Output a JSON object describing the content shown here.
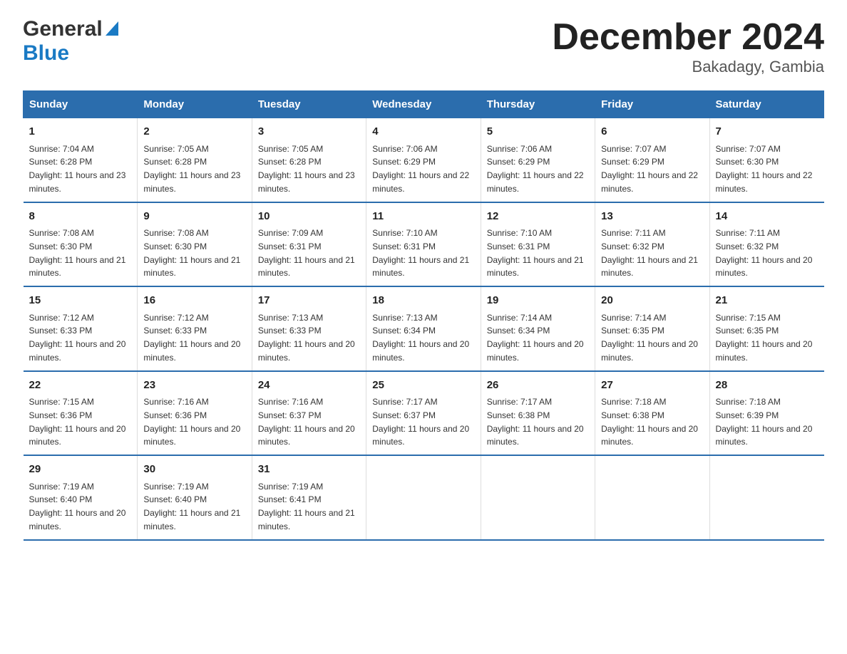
{
  "header": {
    "logo_general": "General",
    "logo_blue": "Blue",
    "title": "December 2024",
    "subtitle": "Bakadagy, Gambia"
  },
  "calendar": {
    "days_of_week": [
      "Sunday",
      "Monday",
      "Tuesday",
      "Wednesday",
      "Thursday",
      "Friday",
      "Saturday"
    ],
    "weeks": [
      [
        {
          "day": "1",
          "sunrise": "7:04 AM",
          "sunset": "6:28 PM",
          "daylight": "11 hours and 23 minutes."
        },
        {
          "day": "2",
          "sunrise": "7:05 AM",
          "sunset": "6:28 PM",
          "daylight": "11 hours and 23 minutes."
        },
        {
          "day": "3",
          "sunrise": "7:05 AM",
          "sunset": "6:28 PM",
          "daylight": "11 hours and 23 minutes."
        },
        {
          "day": "4",
          "sunrise": "7:06 AM",
          "sunset": "6:29 PM",
          "daylight": "11 hours and 22 minutes."
        },
        {
          "day": "5",
          "sunrise": "7:06 AM",
          "sunset": "6:29 PM",
          "daylight": "11 hours and 22 minutes."
        },
        {
          "day": "6",
          "sunrise": "7:07 AM",
          "sunset": "6:29 PM",
          "daylight": "11 hours and 22 minutes."
        },
        {
          "day": "7",
          "sunrise": "7:07 AM",
          "sunset": "6:30 PM",
          "daylight": "11 hours and 22 minutes."
        }
      ],
      [
        {
          "day": "8",
          "sunrise": "7:08 AM",
          "sunset": "6:30 PM",
          "daylight": "11 hours and 21 minutes."
        },
        {
          "day": "9",
          "sunrise": "7:08 AM",
          "sunset": "6:30 PM",
          "daylight": "11 hours and 21 minutes."
        },
        {
          "day": "10",
          "sunrise": "7:09 AM",
          "sunset": "6:31 PM",
          "daylight": "11 hours and 21 minutes."
        },
        {
          "day": "11",
          "sunrise": "7:10 AM",
          "sunset": "6:31 PM",
          "daylight": "11 hours and 21 minutes."
        },
        {
          "day": "12",
          "sunrise": "7:10 AM",
          "sunset": "6:31 PM",
          "daylight": "11 hours and 21 minutes."
        },
        {
          "day": "13",
          "sunrise": "7:11 AM",
          "sunset": "6:32 PM",
          "daylight": "11 hours and 21 minutes."
        },
        {
          "day": "14",
          "sunrise": "7:11 AM",
          "sunset": "6:32 PM",
          "daylight": "11 hours and 20 minutes."
        }
      ],
      [
        {
          "day": "15",
          "sunrise": "7:12 AM",
          "sunset": "6:33 PM",
          "daylight": "11 hours and 20 minutes."
        },
        {
          "day": "16",
          "sunrise": "7:12 AM",
          "sunset": "6:33 PM",
          "daylight": "11 hours and 20 minutes."
        },
        {
          "day": "17",
          "sunrise": "7:13 AM",
          "sunset": "6:33 PM",
          "daylight": "11 hours and 20 minutes."
        },
        {
          "day": "18",
          "sunrise": "7:13 AM",
          "sunset": "6:34 PM",
          "daylight": "11 hours and 20 minutes."
        },
        {
          "day": "19",
          "sunrise": "7:14 AM",
          "sunset": "6:34 PM",
          "daylight": "11 hours and 20 minutes."
        },
        {
          "day": "20",
          "sunrise": "7:14 AM",
          "sunset": "6:35 PM",
          "daylight": "11 hours and 20 minutes."
        },
        {
          "day": "21",
          "sunrise": "7:15 AM",
          "sunset": "6:35 PM",
          "daylight": "11 hours and 20 minutes."
        }
      ],
      [
        {
          "day": "22",
          "sunrise": "7:15 AM",
          "sunset": "6:36 PM",
          "daylight": "11 hours and 20 minutes."
        },
        {
          "day": "23",
          "sunrise": "7:16 AM",
          "sunset": "6:36 PM",
          "daylight": "11 hours and 20 minutes."
        },
        {
          "day": "24",
          "sunrise": "7:16 AM",
          "sunset": "6:37 PM",
          "daylight": "11 hours and 20 minutes."
        },
        {
          "day": "25",
          "sunrise": "7:17 AM",
          "sunset": "6:37 PM",
          "daylight": "11 hours and 20 minutes."
        },
        {
          "day": "26",
          "sunrise": "7:17 AM",
          "sunset": "6:38 PM",
          "daylight": "11 hours and 20 minutes."
        },
        {
          "day": "27",
          "sunrise": "7:18 AM",
          "sunset": "6:38 PM",
          "daylight": "11 hours and 20 minutes."
        },
        {
          "day": "28",
          "sunrise": "7:18 AM",
          "sunset": "6:39 PM",
          "daylight": "11 hours and 20 minutes."
        }
      ],
      [
        {
          "day": "29",
          "sunrise": "7:19 AM",
          "sunset": "6:40 PM",
          "daylight": "11 hours and 20 minutes."
        },
        {
          "day": "30",
          "sunrise": "7:19 AM",
          "sunset": "6:40 PM",
          "daylight": "11 hours and 21 minutes."
        },
        {
          "day": "31",
          "sunrise": "7:19 AM",
          "sunset": "6:41 PM",
          "daylight": "11 hours and 21 minutes."
        },
        null,
        null,
        null,
        null
      ]
    ]
  }
}
